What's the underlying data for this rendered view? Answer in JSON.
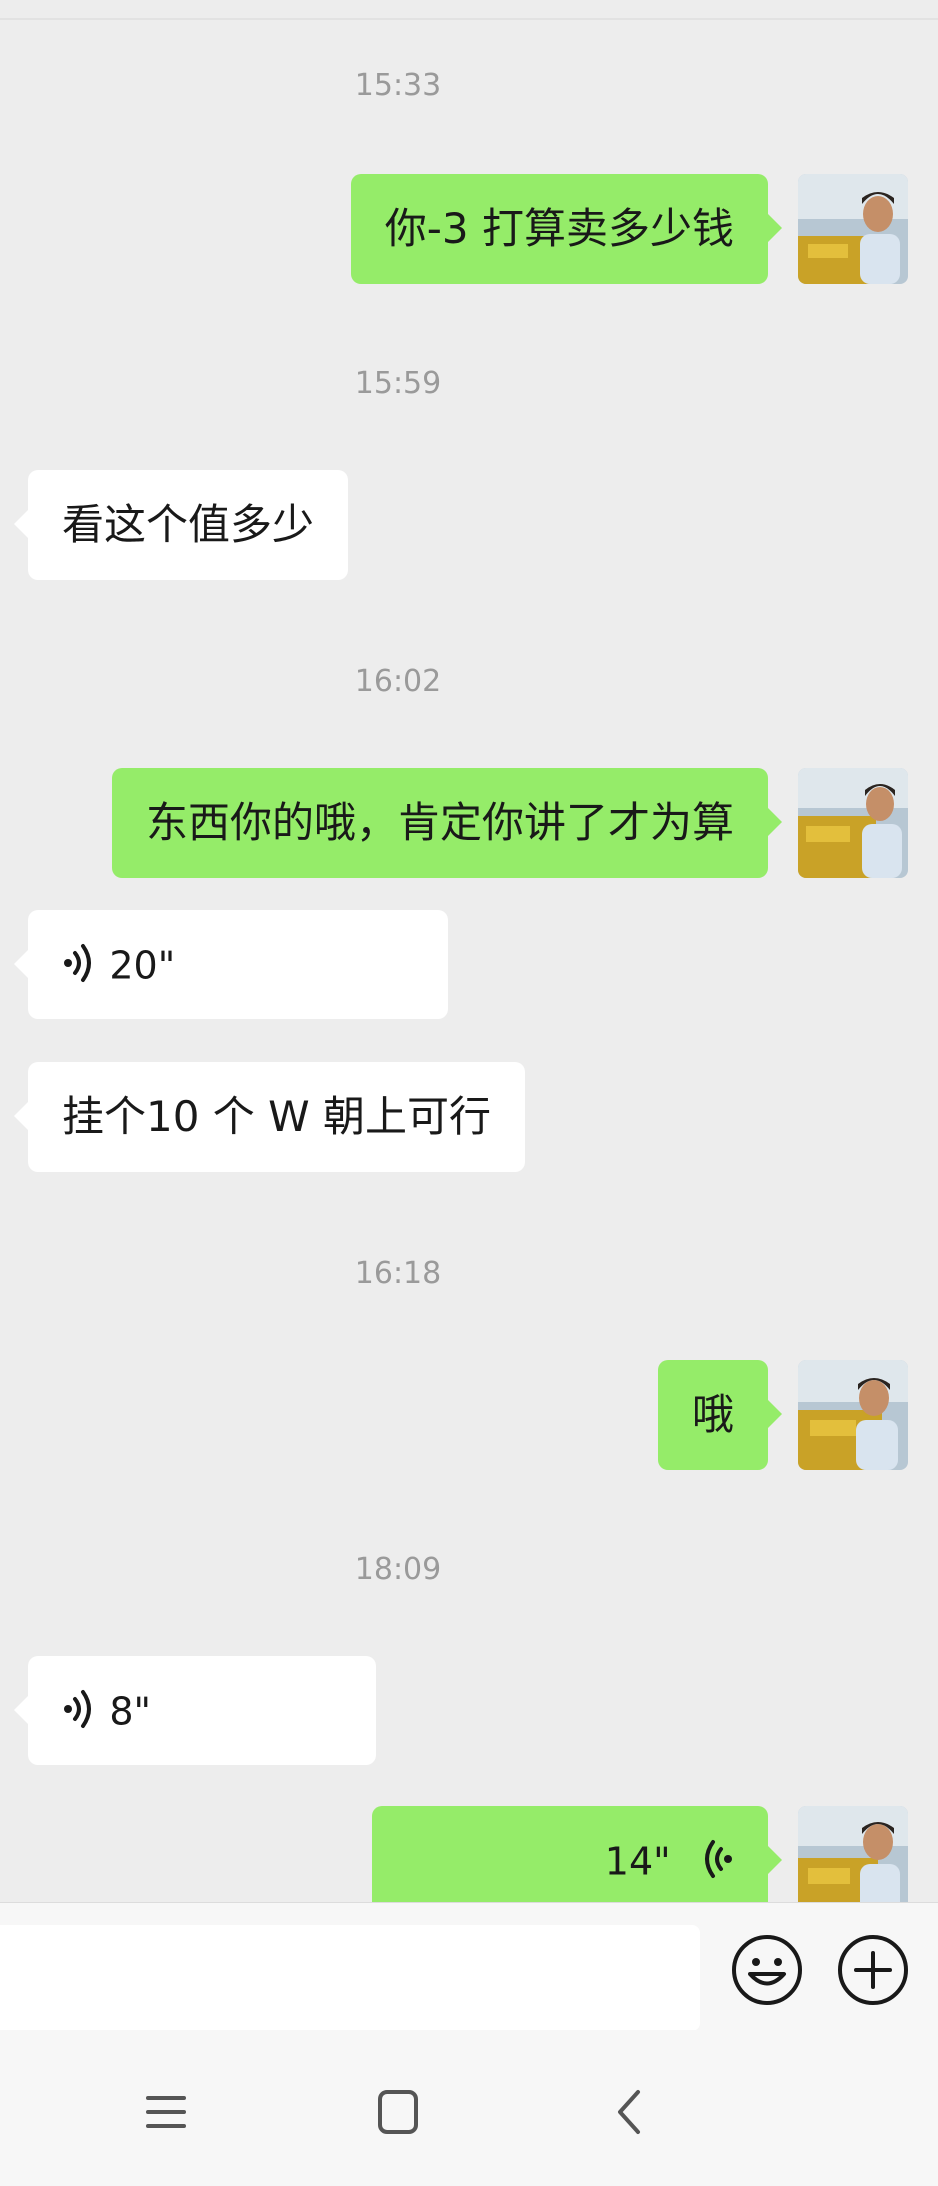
{
  "messages": [
    {
      "type": "time",
      "text": "15:33"
    },
    {
      "type": "text",
      "side": "me",
      "text": "你-3 打算卖多少钱"
    },
    {
      "type": "time",
      "text": "15:59"
    },
    {
      "type": "text",
      "side": "them",
      "text": "看这个值多少"
    },
    {
      "type": "time",
      "text": "16:02"
    },
    {
      "type": "text",
      "side": "me",
      "text": "东西你的哦，肯定你讲了才为算"
    },
    {
      "type": "voice",
      "side": "them",
      "duration": "20\""
    },
    {
      "type": "text",
      "side": "them",
      "text": "挂个10 个 W 朝上可行"
    },
    {
      "type": "time",
      "text": "16:18"
    },
    {
      "type": "text",
      "side": "me",
      "text": "哦"
    },
    {
      "type": "time",
      "text": "18:09"
    },
    {
      "type": "voice",
      "side": "them",
      "duration": "8\""
    },
    {
      "type": "voice",
      "side": "me",
      "duration": "14\""
    }
  ],
  "input_bar": {
    "emoji_icon": "smiley-face-icon",
    "more_icon": "plus-circle-icon"
  },
  "nav_bar": {
    "icons": [
      "menu-icon",
      "home-square-icon",
      "back-chevron-icon"
    ]
  },
  "colors": {
    "background": "#ededed",
    "my_bubble": "#95ec69",
    "their_bubble": "#ffffff",
    "timestamp_text": "#9a9a9a"
  }
}
